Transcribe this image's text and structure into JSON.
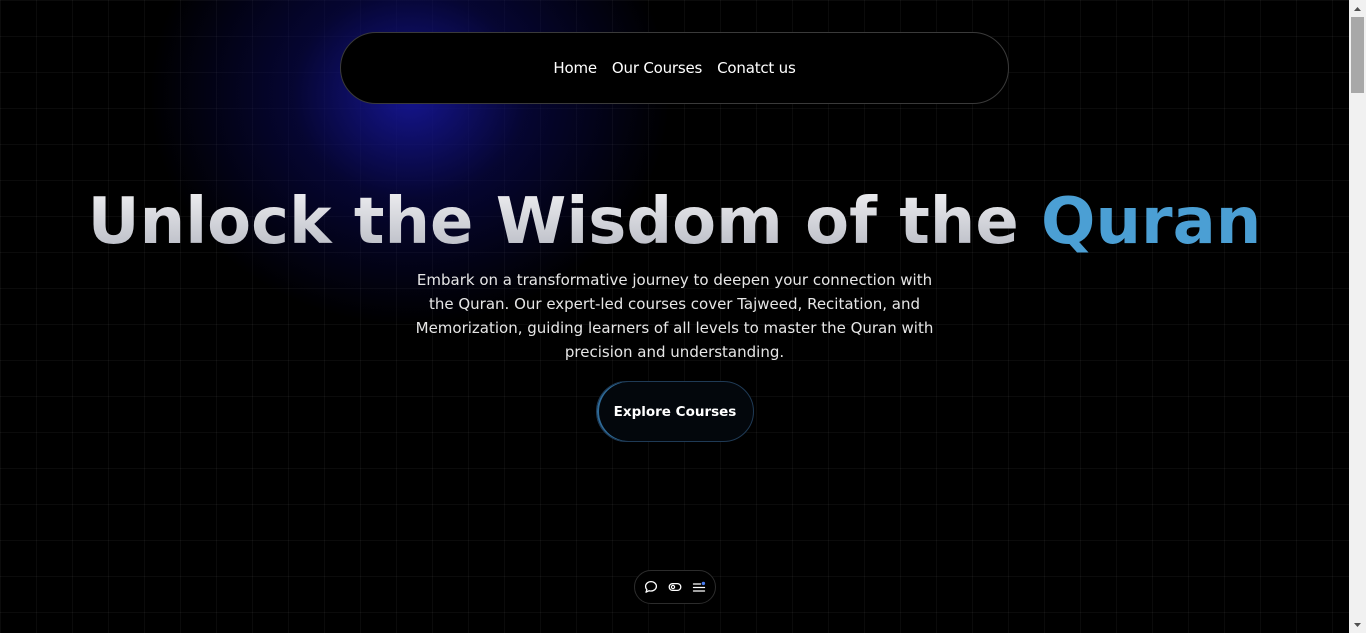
{
  "nav": {
    "items": [
      {
        "label": "Home"
      },
      {
        "label": "Our Courses"
      },
      {
        "label": "Conatct us"
      }
    ]
  },
  "hero": {
    "title_main": "Unlock the Wisdom of the",
    "title_accent": "Quran",
    "description": "Embark on a transformative journey to deepen your connection with the Quran. Our expert-led courses cover Tajweed, Recitation, and Memorization, guiding learners of all levels to master the Quran with precision and understanding.",
    "cta_label": "Explore Courses"
  },
  "toolbar": {
    "icons": [
      "chat-icon",
      "toggle-icon",
      "menu-list-icon"
    ]
  },
  "colors": {
    "background": "#000000",
    "accent": "#4b9fd4",
    "glow": "#16169a",
    "toolbar_dot": "#4a7cf0"
  }
}
